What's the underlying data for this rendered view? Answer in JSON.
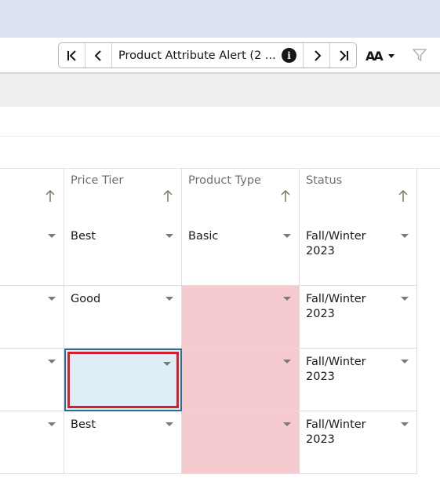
{
  "toolbar": {
    "record_title": "Product Attribute Alert (2 ...",
    "icons": {
      "first": "first-record-icon",
      "prev": "previous-record-icon",
      "info": "info-icon",
      "next": "next-record-icon",
      "last": "last-record-icon",
      "font_size": "font-size-icon",
      "filter": "filter-icon"
    },
    "info_glyph": "i",
    "font_size_glyph": "AA"
  },
  "grid": {
    "columns": [
      {
        "label": ""
      },
      {
        "label": "Price Tier"
      },
      {
        "label": "Product Type"
      },
      {
        "label": "Status"
      }
    ],
    "rows": [
      {
        "col0": "",
        "price_tier": "Best",
        "product_type": "Basic",
        "status": "Fall/Winter 2023",
        "product_type_error": false
      },
      {
        "col0": "",
        "price_tier": "Good",
        "product_type": "",
        "status": "Fall/Winter 2023",
        "product_type_error": true
      },
      {
        "col0": "",
        "price_tier": "",
        "product_type": "",
        "status": "Fall/Winter 2023",
        "product_type_error": true,
        "price_tier_selected": true
      },
      {
        "col0": "",
        "price_tier": "Best",
        "product_type": "",
        "status": "Fall/Winter 2023",
        "product_type_error": true
      }
    ]
  },
  "colors": {
    "top_band": "#dde1f4",
    "error_cell": "#f5cbd0",
    "selected_cell_fill": "#deedf6",
    "selected_outline": "#d3202a",
    "focus_border": "#2d6e91"
  }
}
